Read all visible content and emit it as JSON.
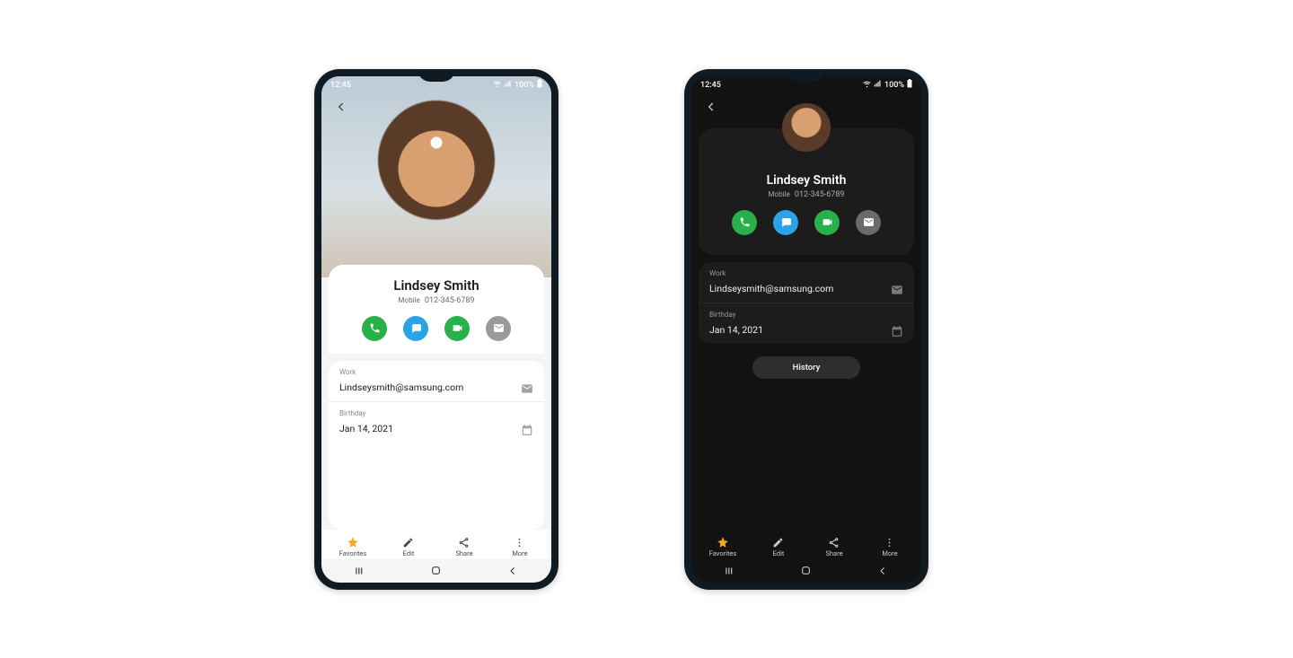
{
  "status": {
    "time": "12:45",
    "battery_text": "100%"
  },
  "contact": {
    "name": "Lindsey Smith",
    "phone_label": "Mobile",
    "phone": "012-345-6789",
    "email_label": "Work",
    "email": "Lindseysmith@samsung.com",
    "birthday_label": "Birthday",
    "birthday": "Jan 14, 2021"
  },
  "actions": {
    "call_color": "#28b04a",
    "message_color": "#2aa3e8",
    "video_color": "#28b04a",
    "email_color": "#9a9a9a"
  },
  "history_button": "History",
  "bottom": {
    "favorites": "Favorites",
    "edit": "Edit",
    "share": "Share",
    "more": "More"
  }
}
